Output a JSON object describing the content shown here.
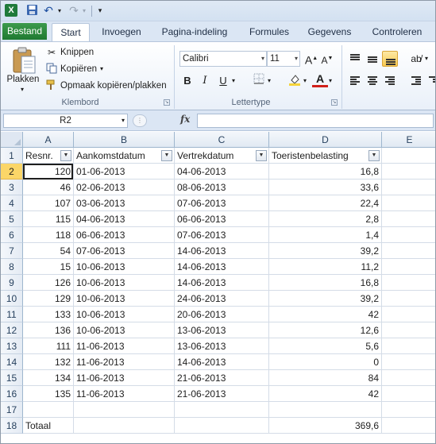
{
  "qat": {
    "logo": "X",
    "save_icon": "save-icon",
    "undo_icon": "undo-icon",
    "redo_icon": "redo-icon"
  },
  "tabs": {
    "file": "Bestand",
    "items": [
      "Start",
      "Invoegen",
      "Pagina-indeling",
      "Formules",
      "Gegevens",
      "Controleren"
    ]
  },
  "ribbon": {
    "clipboard": {
      "paste": "Plakken",
      "cut": "Knippen",
      "copy": "Kopiëren",
      "format_painter": "Opmaak kopiëren/plakken",
      "group_label": "Klembord"
    },
    "font": {
      "name": "Calibri",
      "size": "11",
      "grow": "A",
      "shrink": "A",
      "bold": "B",
      "italic": "I",
      "underline": "U",
      "font_color": "A",
      "group_label": "Lettertype"
    }
  },
  "formula_bar": {
    "name_box": "R2",
    "fx": "fx",
    "value": ""
  },
  "sheet": {
    "columns": [
      "A",
      "B",
      "C",
      "D",
      "E"
    ],
    "rows": [
      {
        "n": "1",
        "a": "Resnr.",
        "b": "Aankomstdatum",
        "c": "Vertrekdatum",
        "d": "Toeristenbelasting",
        "header": true
      },
      {
        "n": "2",
        "a": "120",
        "b": "01-06-2013",
        "c": "04-06-2013",
        "d": "16,8"
      },
      {
        "n": "3",
        "a": "46",
        "b": "02-06-2013",
        "c": "08-06-2013",
        "d": "33,6"
      },
      {
        "n": "4",
        "a": "107",
        "b": "03-06-2013",
        "c": "07-06-2013",
        "d": "22,4"
      },
      {
        "n": "5",
        "a": "115",
        "b": "04-06-2013",
        "c": "06-06-2013",
        "d": "2,8"
      },
      {
        "n": "6",
        "a": "118",
        "b": "06-06-2013",
        "c": "07-06-2013",
        "d": "1,4"
      },
      {
        "n": "7",
        "a": "54",
        "b": "07-06-2013",
        "c": "14-06-2013",
        "d": "39,2"
      },
      {
        "n": "8",
        "a": "15",
        "b": "10-06-2013",
        "c": "14-06-2013",
        "d": "11,2"
      },
      {
        "n": "9",
        "a": "126",
        "b": "10-06-2013",
        "c": "14-06-2013",
        "d": "16,8"
      },
      {
        "n": "10",
        "a": "129",
        "b": "10-06-2013",
        "c": "24-06-2013",
        "d": "39,2"
      },
      {
        "n": "11",
        "a": "133",
        "b": "10-06-2013",
        "c": "20-06-2013",
        "d": "42"
      },
      {
        "n": "12",
        "a": "136",
        "b": "10-06-2013",
        "c": "13-06-2013",
        "d": "12,6"
      },
      {
        "n": "13",
        "a": "111",
        "b": "11-06-2013",
        "c": "13-06-2013",
        "d": "5,6"
      },
      {
        "n": "14",
        "a": "132",
        "b": "11-06-2013",
        "c": "14-06-2013",
        "d": "0"
      },
      {
        "n": "15",
        "a": "134",
        "b": "11-06-2013",
        "c": "21-06-2013",
        "d": "84"
      },
      {
        "n": "16",
        "a": "135",
        "b": "11-06-2013",
        "c": "21-06-2013",
        "d": "42"
      },
      {
        "n": "17",
        "a": "",
        "b": "",
        "c": "",
        "d": ""
      },
      {
        "n": "18",
        "a": "Totaal",
        "b": "",
        "c": "",
        "d": "369,6",
        "total": true
      }
    ],
    "selected_row": "2",
    "filter_icon": "filter-dropdown-icon"
  }
}
